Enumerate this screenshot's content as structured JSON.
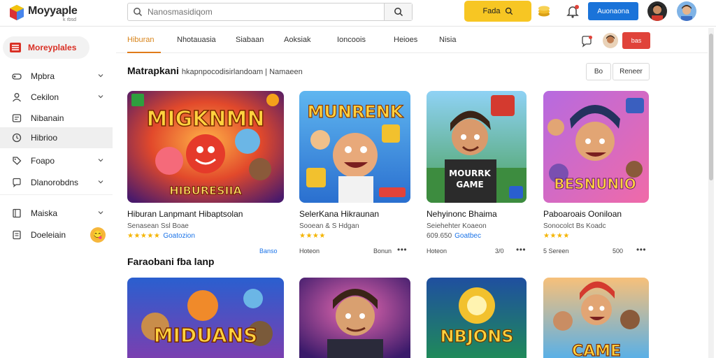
{
  "header": {
    "logo_text": "Moyyaple",
    "logo_sub": "k rbsd",
    "search_placeholder": "Nanosmasidiqom",
    "promo_label": "Fada",
    "login_label": "Auonaona"
  },
  "sidebar": {
    "head_label": "Moreyplales",
    "items": [
      {
        "label": "Mpbra",
        "icon": "gamepad-icon",
        "chevron": true
      },
      {
        "label": "Cekilon",
        "icon": "person-icon",
        "chevron": true
      },
      {
        "label": "Nibanain",
        "icon": "card-icon",
        "chevron": false
      },
      {
        "label": "Hibrioo",
        "icon": "clock-icon",
        "chevron": false,
        "active": true
      },
      {
        "label": "Foapo",
        "icon": "tag-icon",
        "chevron": true
      },
      {
        "label": "Dlanorobdns",
        "icon": "chat-icon",
        "chevron": true
      },
      {
        "label": "Maiska",
        "icon": "book-icon",
        "chevron": true
      },
      {
        "label": "Doeleiain",
        "icon": "doc-icon",
        "chevron": false
      }
    ]
  },
  "tabs": {
    "items": [
      "Hiburan",
      "Nhotauasia",
      "Siabaan",
      "Aoksiak",
      "Ioncoois",
      "Heioes",
      "Nisia"
    ],
    "active_index": 0,
    "action_label": "bas"
  },
  "main": {
    "section1_title": "Matrapkani",
    "section1_sub": "hkapnpocodisirlandoam | Namaeen",
    "filter_left": "Bo",
    "filter_right": "Reneer",
    "section2_title": "Faraobani fba lanp",
    "cards": [
      {
        "title": "Hiburan Lanpmant Hibaptsolan",
        "meta": "Senasean Ssl Boae",
        "stars": "★★★★★",
        "rating": "Goatozion",
        "foot": "Banso"
      },
      {
        "title": "SelerKana Hikraunan",
        "meta": "Sooean & S Hdgan",
        "stars": "★★★★",
        "rating": "",
        "foot_left": "Hoteon",
        "foot_right": "Bonun"
      },
      {
        "title": "Nehyinonc Bhaima",
        "meta": "Seiehehter Koaeon",
        "stars": "609.650",
        "rating": "Goatbec",
        "foot_left": "Hoteon",
        "foot_right": "3/0"
      },
      {
        "title": "Paboaroais Ooniloan",
        "meta": "Sonocolct Bs Koadc",
        "stars": "★★★★",
        "rating": "",
        "foot_left": "5 Sereen",
        "foot_right": "500"
      }
    ],
    "game_art": [
      {
        "headline": "MIGKNMN",
        "caption": "HIBURESIIA"
      },
      {
        "headline": "MUNRENK",
        "caption": ""
      },
      {
        "headline": "MOURRK",
        "caption": "GAME"
      },
      {
        "headline": "BESNUNIO",
        "caption": ""
      },
      {
        "headline": "MIDUANS",
        "caption": ""
      },
      {
        "headline": "",
        "caption": ""
      },
      {
        "headline": "NBJONS",
        "caption": ""
      },
      {
        "headline": "CAME",
        "caption": ""
      }
    ]
  },
  "colors": {
    "accent_orange": "#e07b1a",
    "promo_yellow": "#f7c623",
    "login_blue": "#1a73d9",
    "badge_red": "#e0433a"
  }
}
